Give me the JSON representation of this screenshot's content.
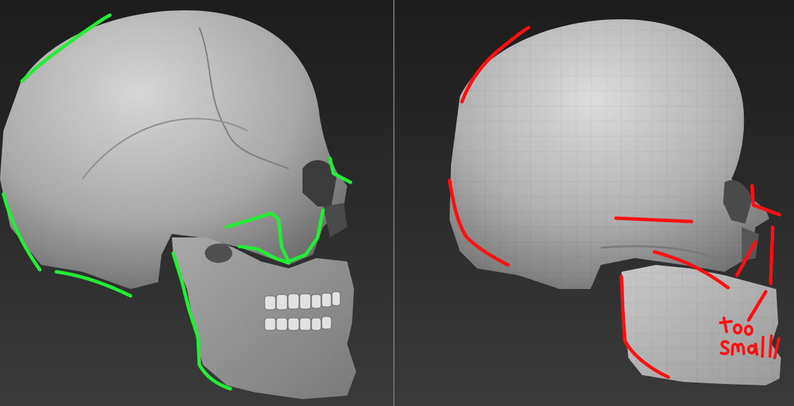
{
  "colors": {
    "background_top": "#1c1c1c",
    "background_bottom": "#3a3a3a",
    "divider": "#6e6e6e",
    "skull_fill": "#b8b8b8",
    "green_annotation": "#22ee33",
    "red_annotation": "#ff1010"
  },
  "left_panel": {
    "subject": "reference-skull-sculpt",
    "annotation_color": "green"
  },
  "right_panel": {
    "subject": "lowpoly-skull-sculpt",
    "annotation_color": "red",
    "handwritten_note": "too small"
  }
}
